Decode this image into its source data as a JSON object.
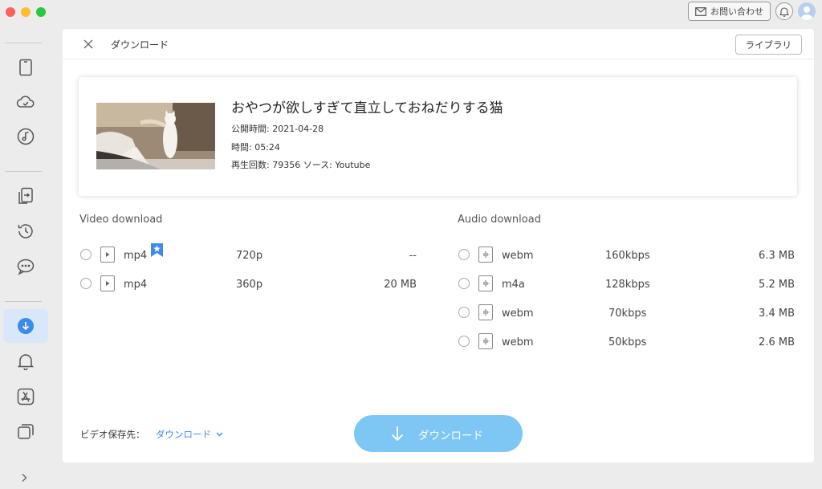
{
  "topbar": {
    "contact_label": "お問い合わせ"
  },
  "sidebar": {
    "items": [
      "device-icon",
      "cloud-icon",
      "music-icon",
      "transfer-icon",
      "history-icon",
      "chat-icon",
      "download-icon",
      "bell-icon",
      "appstore-icon",
      "layers-icon"
    ],
    "active": "download-icon"
  },
  "panel": {
    "title": "ダウンロード",
    "library_label": "ライブラリ"
  },
  "video": {
    "title": "おやつが欲しすぎて直立しておねだりする猫",
    "published": "公開時間: 2021-04-28",
    "duration": "時間: 05:24",
    "views_source": "再生回数: 79356  ソース: Youtube"
  },
  "video_download": {
    "heading": "Video download",
    "options": [
      {
        "format": "mp4",
        "quality": "720p",
        "size": "--",
        "recommended": true
      },
      {
        "format": "mp4",
        "quality": "360p",
        "size": "20 MB",
        "recommended": false
      }
    ]
  },
  "audio_download": {
    "heading": "Audio download",
    "options": [
      {
        "format": "webm",
        "bitrate": "160kbps",
        "size": "6.3 MB"
      },
      {
        "format": "m4a",
        "bitrate": "128kbps",
        "size": "5.2 MB"
      },
      {
        "format": "webm",
        "bitrate": "70kbps",
        "size": "3.4 MB"
      },
      {
        "format": "webm",
        "bitrate": "50kbps",
        "size": "2.6 MB"
      }
    ]
  },
  "footer": {
    "save_label": "ビデオ保存先：",
    "save_path": "ダウンロード",
    "download_label": "ダウンロード"
  },
  "colors": {
    "accent": "#3c8ce7",
    "download_button": "#7ec6f4",
    "active_sidebar": "#d8e8fa",
    "badge": "#3c8ce7"
  }
}
